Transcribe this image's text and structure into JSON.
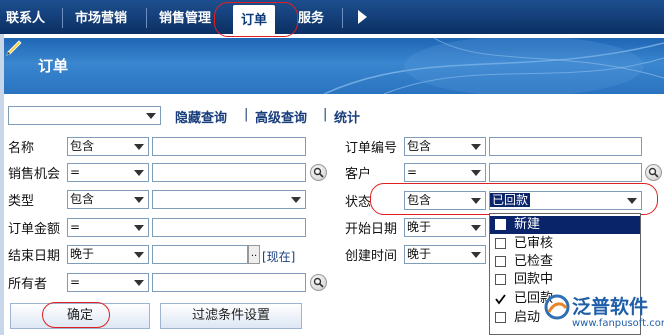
{
  "tabs": [
    {
      "label": "联系人"
    },
    {
      "label": "市场营销"
    },
    {
      "label": "销售管理"
    },
    {
      "label": "订单"
    },
    {
      "label": "服务"
    }
  ],
  "banner": {
    "title": "订单"
  },
  "query": {
    "hide_link": "隐藏查询",
    "advanced_link": "高级查询",
    "stats_link": "统计",
    "separator": "|"
  },
  "fields": {
    "name": {
      "label": "名称",
      "op": "包含"
    },
    "opportunity": {
      "label": "销售机会",
      "op": "="
    },
    "type": {
      "label": "类型",
      "op": "包含"
    },
    "amount": {
      "label": "订单金额",
      "op": "="
    },
    "end_date": {
      "label": "结束日期",
      "op": "晚于",
      "dots": "..",
      "now_link": "[现在]"
    },
    "owner": {
      "label": "所有者",
      "op": "="
    },
    "order_no": {
      "label": "订单编号",
      "op": "包含"
    },
    "customer": {
      "label": "客户",
      "op": "="
    },
    "status": {
      "label": "状态",
      "op": "包含",
      "value": "已回款"
    },
    "start_date": {
      "label": "开始日期",
      "op": "晚于"
    },
    "created": {
      "label": "创建时间",
      "op": "晚于"
    }
  },
  "status_options": [
    {
      "label": "新建",
      "checked": false,
      "highlighted": true
    },
    {
      "label": "已审核",
      "checked": false,
      "highlighted": false
    },
    {
      "label": "已检查",
      "checked": false,
      "highlighted": false
    },
    {
      "label": "回款中",
      "checked": false,
      "highlighted": false
    },
    {
      "label": "已回款",
      "checked": true,
      "highlighted": false
    },
    {
      "label": "启动",
      "checked": false,
      "highlighted": false
    }
  ],
  "buttons": {
    "confirm": "确定",
    "filter": "过滤条件设置"
  },
  "watermark": {
    "brand": "泛普软件",
    "url": "www.fanpusoft.com"
  },
  "colors": {
    "topbar": "#0b2f63",
    "banner": "#2a73c0",
    "highlight": "#0a246a",
    "annotation": "#e02020"
  },
  "icons": [
    "pencil-icon",
    "magnifier-icon",
    "dropdown-arrow-icon",
    "chevron-right-icon",
    "checkbox-icon"
  ]
}
